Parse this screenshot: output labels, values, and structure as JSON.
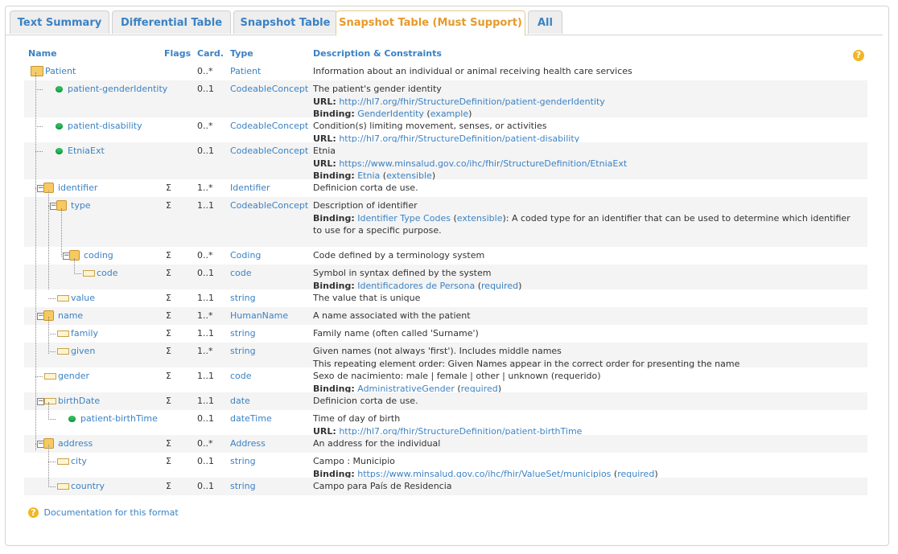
{
  "tabs": [
    "Text Summary",
    "Differential Table",
    "Snapshot Table",
    "Snapshot Table (Must Support)",
    "All"
  ],
  "columns": [
    "Name",
    "Flags",
    "Card.",
    "Type",
    "Description & Constraints"
  ],
  "rows": [
    {
      "name": "Patient",
      "flags": "",
      "card": "0..*",
      "type": "Patient",
      "desc": [
        "Information about an individual or animal receiving health care services"
      ]
    },
    {
      "name": "patient-genderIdentity",
      "flags": "",
      "card": "0..1",
      "type": "CodeableConcept",
      "desc": [
        "The patient's gender identity"
      ],
      "url": "http://hl7.org/fhir/StructureDefinition/patient-genderIdentity",
      "binding": {
        "value": "GenderIdentity",
        "strength": "example"
      }
    },
    {
      "name": "patient-disability",
      "flags": "",
      "card": "0..*",
      "type": "CodeableConcept",
      "desc": [
        "Condition(s) limiting movement, senses, or activities"
      ],
      "url": "http://hl7.org/fhir/StructureDefinition/patient-disability"
    },
    {
      "name": "EtniaExt",
      "flags": "",
      "card": "0..1",
      "type": "CodeableConcept",
      "desc": [
        "Etnia"
      ],
      "url": "https://www.minsalud.gov.co/ihc/fhir/StructureDefinition/EtniaExt",
      "binding": {
        "value": "Etnia",
        "strength": "extensible"
      }
    },
    {
      "name": "identifier",
      "flags": "Σ",
      "card": "1..*",
      "type": "Identifier",
      "desc": [
        "Definicion corta de use."
      ]
    },
    {
      "name": "type",
      "flags": "Σ",
      "card": "1..1",
      "type": "CodeableConcept",
      "desc": [
        "Description of identifier"
      ],
      "binding": {
        "value": "Identifier Type Codes",
        "strength": "extensible",
        "extra": ": A coded type for an identifier that can be used to determine which identifier",
        "extra2": "to use for a specific purpose."
      }
    },
    {
      "name": "coding",
      "flags": "Σ",
      "card": "0..*",
      "type": "Coding",
      "desc": [
        "Code defined by a terminology system"
      ]
    },
    {
      "name": "code",
      "flags": "Σ",
      "card": "0..1",
      "type": "code",
      "desc": [
        "Symbol in syntax defined by the system"
      ],
      "binding": {
        "value": "Identificadores de Persona",
        "strength": "required"
      }
    },
    {
      "name": "value",
      "flags": "Σ",
      "card": "1..1",
      "type": "string",
      "desc": [
        "The value that is unique"
      ]
    },
    {
      "name": "name",
      "flags": "Σ",
      "card": "1..*",
      "type": "HumanName",
      "desc": [
        "A name associated with the patient"
      ]
    },
    {
      "name": "family",
      "flags": "Σ",
      "card": "1..1",
      "type": "string",
      "desc": [
        "Family name (often called 'Surname')"
      ]
    },
    {
      "name": "given",
      "flags": "Σ",
      "card": "1..*",
      "type": "string",
      "desc": [
        "Given names (not always 'first'). Includes middle names",
        "This repeating element order: Given Names appear in the correct order for presenting the name"
      ]
    },
    {
      "name": "gender",
      "flags": "Σ",
      "card": "1..1",
      "type": "code",
      "desc": [
        "Sexo de nacimiento: male | female | other | unknown (requerido)"
      ],
      "binding": {
        "value": "AdministrativeGender",
        "strength": "required"
      }
    },
    {
      "name": "birthDate",
      "flags": "Σ",
      "card": "1..1",
      "type": "date",
      "desc": [
        "Definicion corta de use."
      ]
    },
    {
      "name": "patient-birthTime",
      "flags": "",
      "card": "0..1",
      "type": "dateTime",
      "desc": [
        "Time of day of birth"
      ],
      "url": "http://hl7.org/fhir/StructureDefinition/patient-birthTime"
    },
    {
      "name": "address",
      "flags": "Σ",
      "card": "0..*",
      "type": "Address",
      "desc": [
        "An address for the individual"
      ]
    },
    {
      "name": "city",
      "flags": "Σ",
      "card": "0..1",
      "type": "string",
      "desc": [
        "Campo : Municipio"
      ],
      "binding": {
        "value": "https://www.minsalud.gov.co/ihc/fhir/ValueSet/municipios",
        "strength": "required"
      }
    },
    {
      "name": "country",
      "flags": "Σ",
      "card": "0..1",
      "type": "string",
      "desc": [
        "Campo para País de Residencia"
      ]
    }
  ],
  "labels": {
    "url": "URL:",
    "binding": "Binding:"
  },
  "help_icon": "question-mark-icon",
  "documentation_link": "Documentation for this format"
}
